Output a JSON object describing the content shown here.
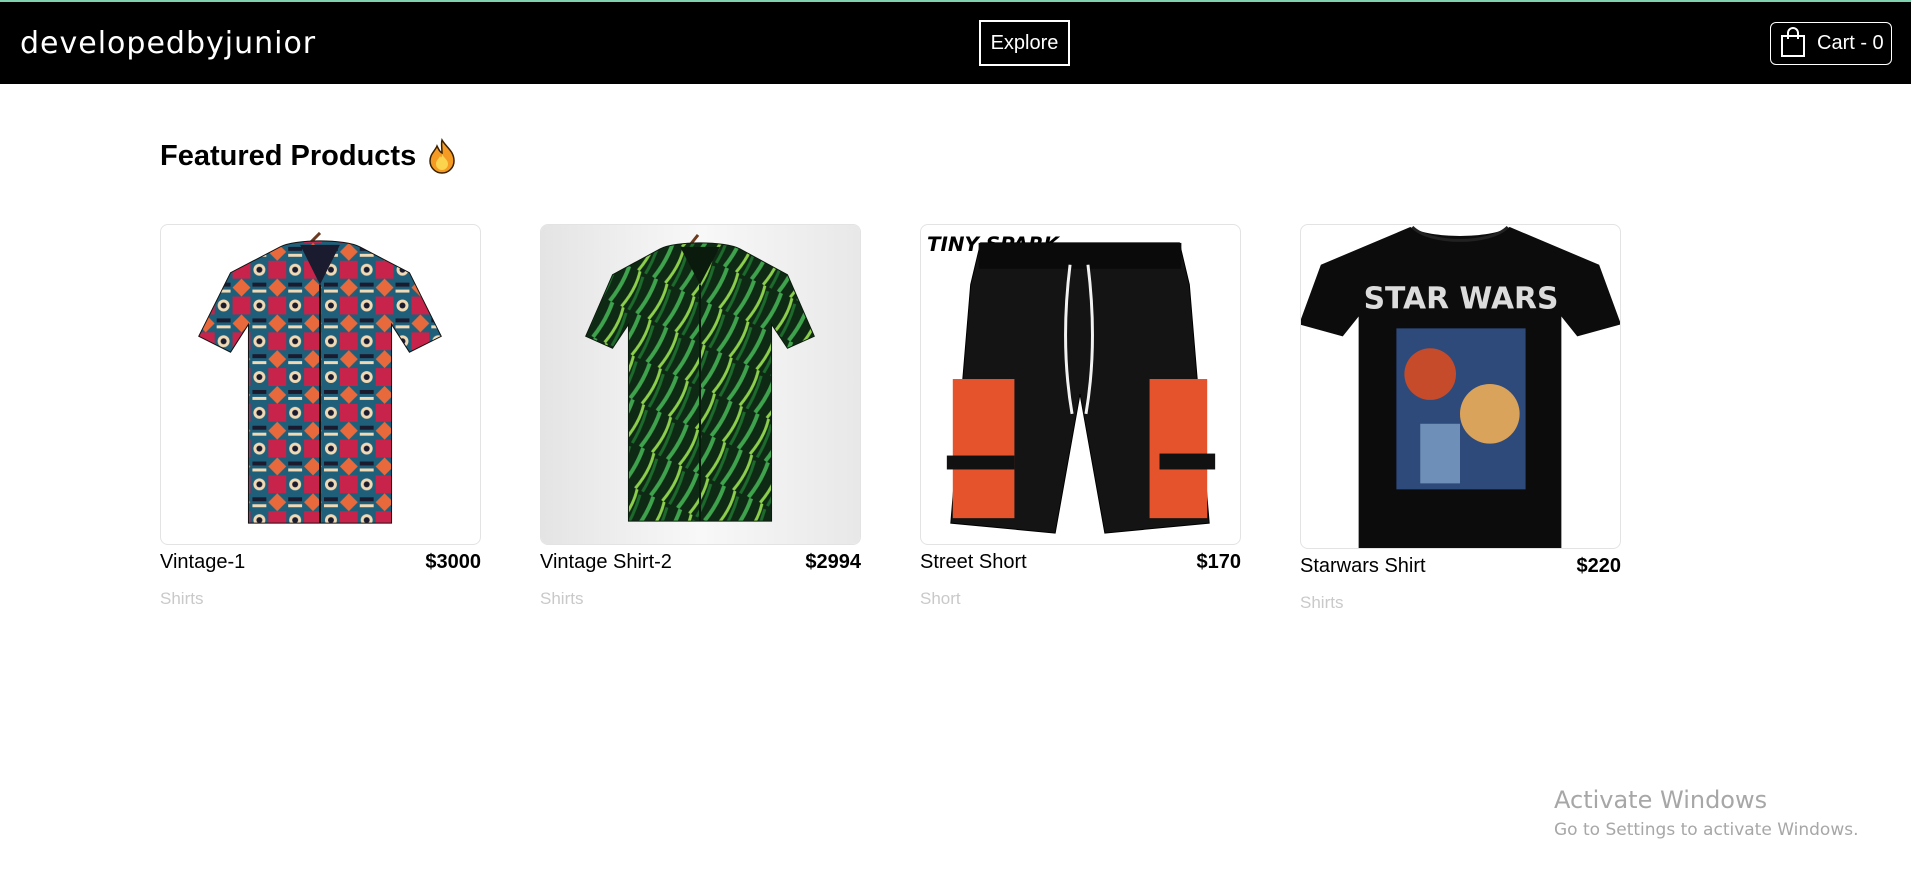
{
  "header": {
    "brand": "developedbyjunior",
    "explore_label": "Explore",
    "cart_label": "Cart - 0",
    "cart_icon": "shopping-bag-icon"
  },
  "main": {
    "section_title": "Featured Products",
    "section_icon": "fire-icon",
    "products": [
      {
        "name": "Vintage-1",
        "price": "$3000",
        "category": "Shirts",
        "image": "patterned-shirt"
      },
      {
        "name": "Vintage Shirt-2",
        "price": "$2994",
        "category": "Shirts",
        "image": "leaf-print-shirt"
      },
      {
        "name": "Street Short",
        "price": "$170",
        "category": "Short",
        "image": "cargo-shorts"
      },
      {
        "name": "Starwars Shirt",
        "price": "$220",
        "category": "Shirts",
        "image": "star-wars-tshirt"
      }
    ],
    "image_texts": {
      "shorts_brand": "TINY SPARK",
      "tshirt_print": "STAR WARS"
    }
  },
  "watermark": {
    "title": "Activate Windows",
    "subtitle": "Go to Settings to activate Windows."
  },
  "colors": {
    "navbar_bg": "#000000",
    "accent_line": "#7fd1b0",
    "category_text": "#c9c9c9",
    "watermark_text": "#a7a7a7"
  }
}
